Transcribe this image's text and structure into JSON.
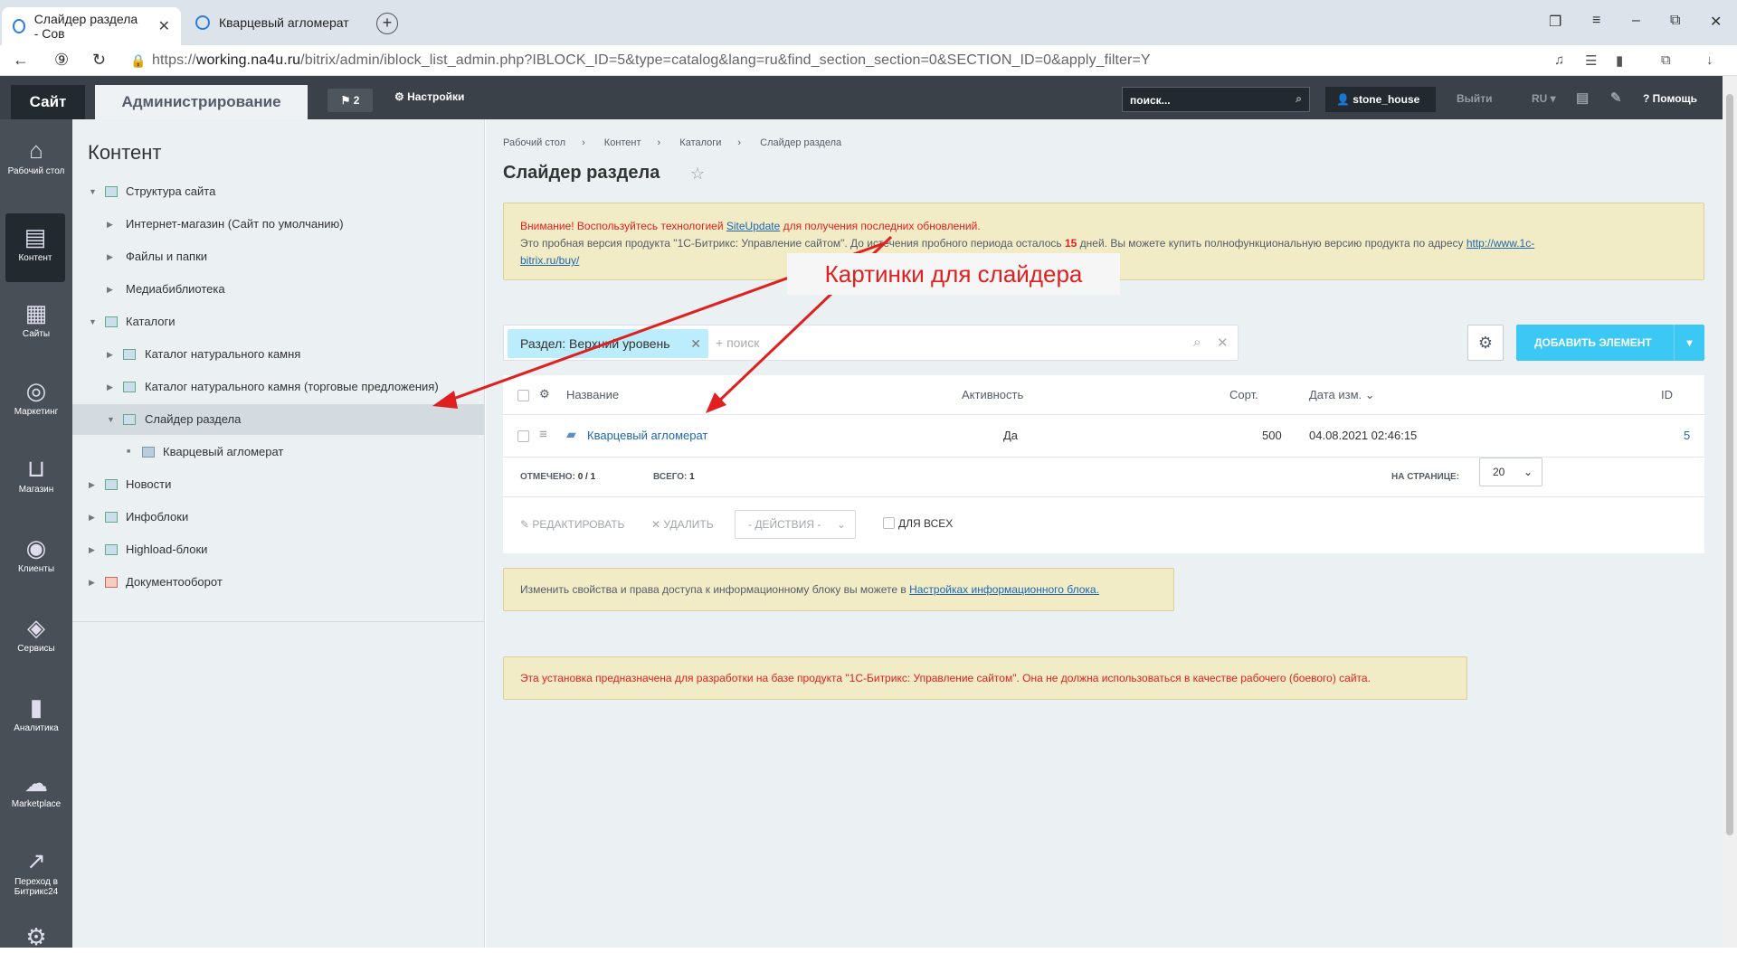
{
  "browser": {
    "tabs": [
      {
        "title": "Слайдер раздела - Сов",
        "active": true
      },
      {
        "title": "Кварцевый агломерат",
        "active": false
      }
    ],
    "url_prefix": "https://",
    "url_host": "working.na4u.ru",
    "url_path": "/bitrix/admin/iblock_list_admin.php?IBLOCK_ID=5&type=catalog&lang=ru&find_section_section=0&SECTION_ID=0&apply_filter=Y"
  },
  "topbar": {
    "site_label": "Сайт",
    "admin_label": "Администрирование",
    "notifications_count": "2",
    "settings_label": "Настройки",
    "search_placeholder": "поиск...",
    "user_name": "stone_house",
    "logout_label": "Выйти",
    "lang_label": "RU",
    "help_label": "Помощь"
  },
  "sidebar": {
    "items": [
      {
        "label": "Рабочий стол",
        "icon": "home-icon"
      },
      {
        "label": "Контент",
        "icon": "document-icon"
      },
      {
        "label": "Сайты",
        "icon": "calendar-24-icon"
      },
      {
        "label": "Маркетинг",
        "icon": "target-icon"
      },
      {
        "label": "Магазин",
        "icon": "basket-icon"
      },
      {
        "label": "Клиенты",
        "icon": "crm-24-icon"
      },
      {
        "label": "Сервисы",
        "icon": "layers-icon"
      },
      {
        "label": "Аналитика",
        "icon": "bar-chart-icon"
      },
      {
        "label": "Marketplace",
        "icon": "cloud-download-icon"
      },
      {
        "label": "Переход в Битрикс24",
        "icon": "goto-icon"
      }
    ]
  },
  "left_panel": {
    "title": "Контент",
    "tree": [
      {
        "label": "Структура сайта"
      },
      {
        "label": "Интернет-магазин (Сайт по умолчанию)"
      },
      {
        "label": "Файлы и папки"
      },
      {
        "label": "Медиабиблиотека"
      },
      {
        "label": "Каталоги"
      },
      {
        "label": "Каталог натурального камня"
      },
      {
        "label": "Каталог натурального камня (торговые предложения)"
      },
      {
        "label": "Слайдер раздела"
      },
      {
        "label": "Кварцевый агломерат"
      },
      {
        "label": "Новости"
      },
      {
        "label": "Инфоблоки"
      },
      {
        "label": "Highload-блоки"
      },
      {
        "label": "Документооборот"
      }
    ]
  },
  "main": {
    "breadcrumbs": [
      "Рабочий стол",
      "Контент",
      "Каталоги",
      "Слайдер раздела"
    ],
    "title": "Слайдер раздела",
    "alert1": {
      "line1_prefix": "Внимание! Воспользуйтесь технологией ",
      "line1_link": "SiteUpdate",
      "line1_suffix": " для получения последних обновлений.",
      "line2_prefix": "Это пробная версия продукта \"1С-Битрикс: Управление сайтом\". До истечения пробного периода осталось ",
      "days": "15",
      "line2_suffix": " дней. Вы можете купить полнофункциональную версию продукта по адресу ",
      "link1": "http://www.1c-",
      "link2": "bitrix.ru/buy/"
    },
    "callout": "Картинки для слайдера",
    "filter": {
      "chip": "Раздел: Верхний уровень",
      "placeholder": "+ поиск"
    },
    "add_button": "ДОБАВИТЬ ЭЛЕМЕНТ",
    "grid": {
      "columns": [
        "Название",
        "Активность",
        "Сорт.",
        "Дата изм.",
        "ID"
      ],
      "rows": [
        {
          "name": "Кварцевый агломерат",
          "active": "Да",
          "sort": "500",
          "date": "04.08.2021 02:46:15",
          "id": "5"
        }
      ],
      "selected_label": "ОТМЕЧЕНО:",
      "selected_value": "0 / 1",
      "total_label": "ВСЕГО:",
      "total_value": "1",
      "per_page_label": "НА СТРАНИЦЕ:",
      "per_page_value": "20"
    },
    "actions": {
      "edit": "РЕДАКТИРОВАТЬ",
      "delete": "УДАЛИТЬ",
      "select": "- ДЕЙСТВИЯ -",
      "for_all": "ДЛЯ ВСЕХ"
    },
    "alert2": {
      "text": "Изменить свойства и права доступа к информационному блоку вы можете в ",
      "link": "Настройках информационного блока."
    },
    "alert3": "Эта установка предназначена для разработки на базе продукта \"1С-Битрикс: Управление сайтом\". Она не должна использоваться в качестве рабочего (боевого) сайта."
  }
}
